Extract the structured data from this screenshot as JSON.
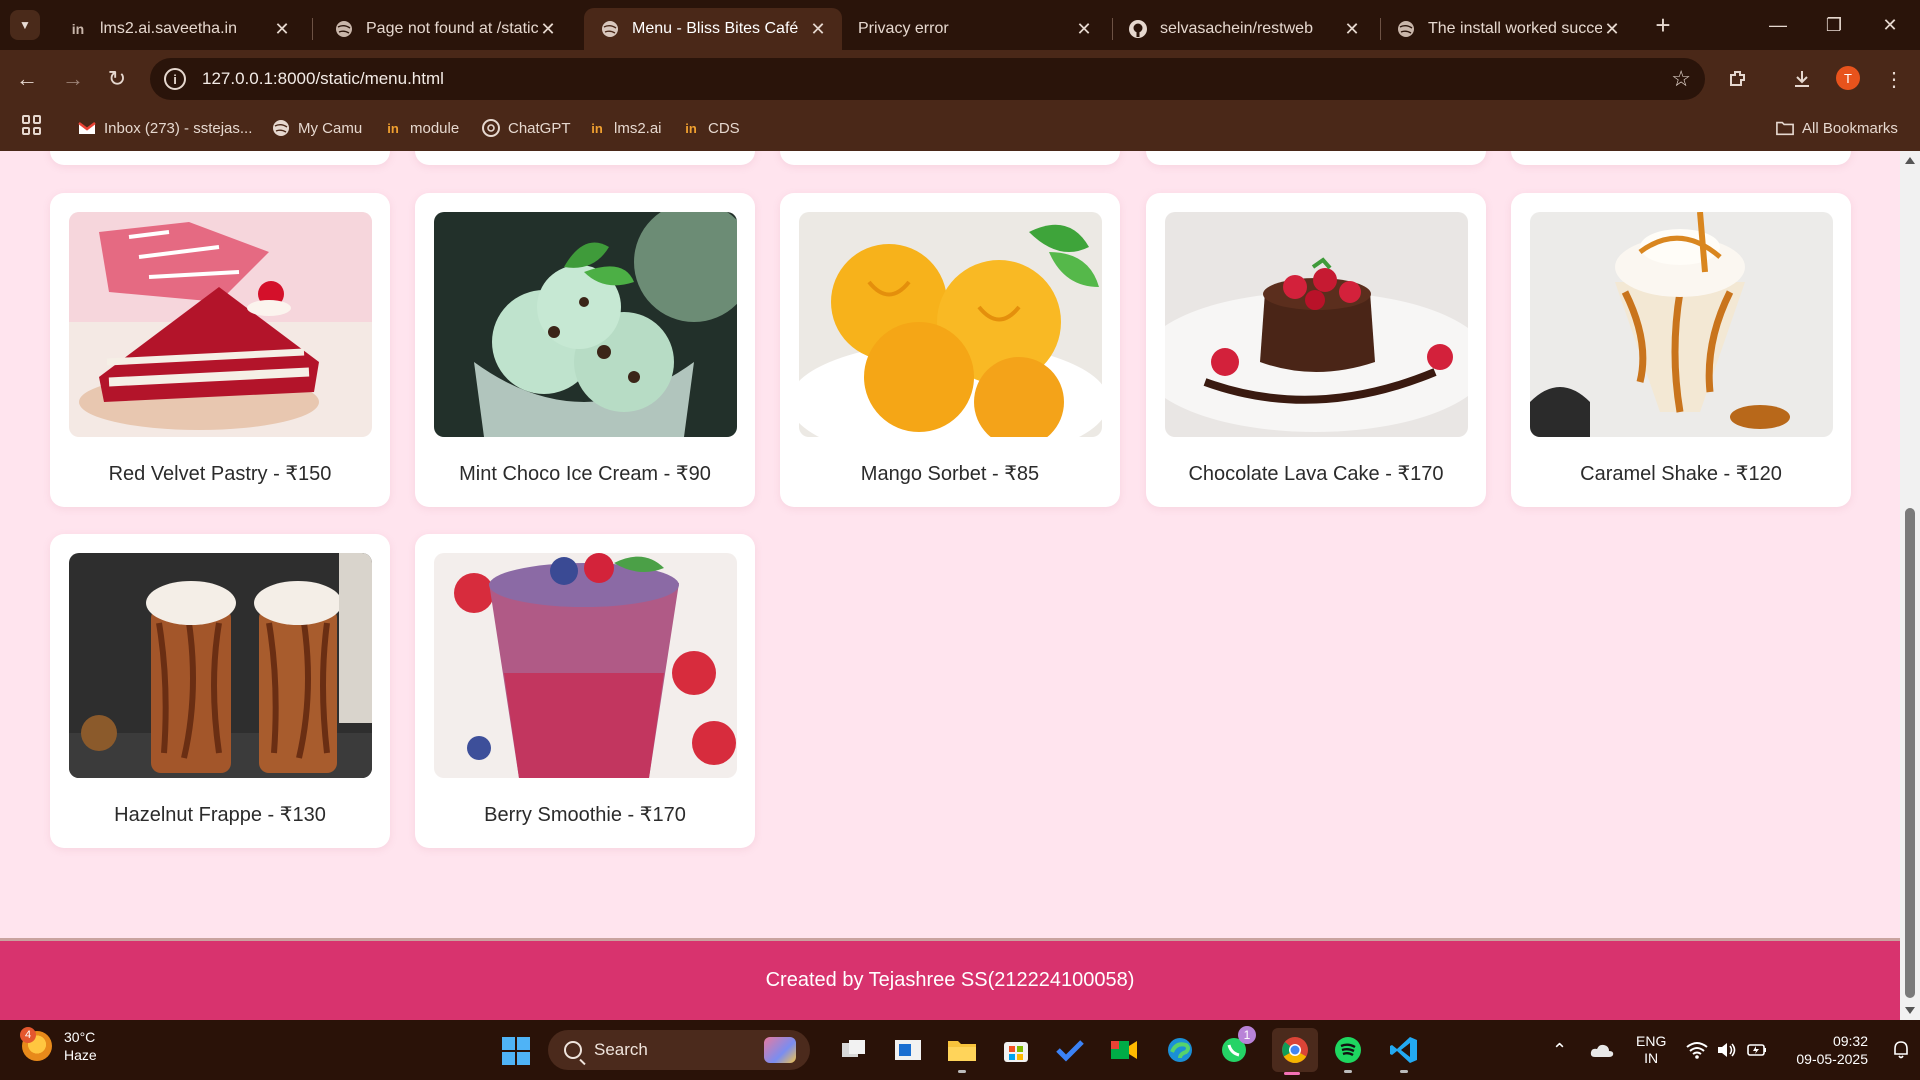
{
  "browser": {
    "tabs": [
      {
        "title": "lms2.ai.saveetha.in",
        "icon": "saveetha-logo-icon",
        "active": false
      },
      {
        "title": "Page not found at /static/i",
        "icon": "globe-icon",
        "active": false
      },
      {
        "title": "Menu - Bliss Bites Café",
        "icon": "globe-icon",
        "active": true
      },
      {
        "title": "Privacy error",
        "icon": "",
        "active": false
      },
      {
        "title": "selvasachein/restweb",
        "icon": "github-icon",
        "active": false
      },
      {
        "title": "The install worked success",
        "icon": "globe-icon",
        "active": false
      }
    ],
    "url": "127.0.0.1:8000/static/menu.html",
    "profile_initial": "T",
    "bookmarks": [
      {
        "label": "Inbox (273) - sstejas...",
        "icon": "gmail-icon"
      },
      {
        "label": "My Camu",
        "icon": "globe-icon"
      },
      {
        "label": "module",
        "icon": "saveetha-logo-icon"
      },
      {
        "label": "ChatGPT",
        "icon": "chatgpt-icon"
      },
      {
        "label": "lms2.ai",
        "icon": "saveetha-logo-icon"
      },
      {
        "label": "CDS",
        "icon": "saveetha-logo-icon"
      }
    ],
    "all_bookmarks": "All Bookmarks"
  },
  "menu": {
    "items": [
      {
        "label": "Red Velvet Pastry - ₹150",
        "image": "red-velvet-pastry-image"
      },
      {
        "label": "Mint Choco Ice Cream - ₹90",
        "image": "mint-choco-ice-cream-image"
      },
      {
        "label": "Mango Sorbet - ₹85",
        "image": "mango-sorbet-image"
      },
      {
        "label": "Chocolate Lava Cake - ₹170",
        "image": "chocolate-lava-cake-image"
      },
      {
        "label": "Caramel Shake - ₹120",
        "image": "caramel-shake-image"
      },
      {
        "label": "Hazelnut Frappe - ₹130",
        "image": "hazelnut-frappe-image"
      },
      {
        "label": "Berry Smoothie - ₹170",
        "image": "berry-smoothie-image"
      }
    ],
    "footer": "Created by Tejashree SS(212224100058)"
  },
  "colors": {
    "page_bg": "#ffe4ee",
    "footer_bg": "#d8336e",
    "browser_frame": "#4a2818"
  },
  "taskbar": {
    "weather": {
      "temp": "30°C",
      "condition": "Haze",
      "badge": "4"
    },
    "search_placeholder": "Search",
    "whatsapp_badge": "1",
    "language": {
      "line1": "ENG",
      "line2": "IN"
    },
    "time": "09:32",
    "date": "09-05-2025"
  }
}
